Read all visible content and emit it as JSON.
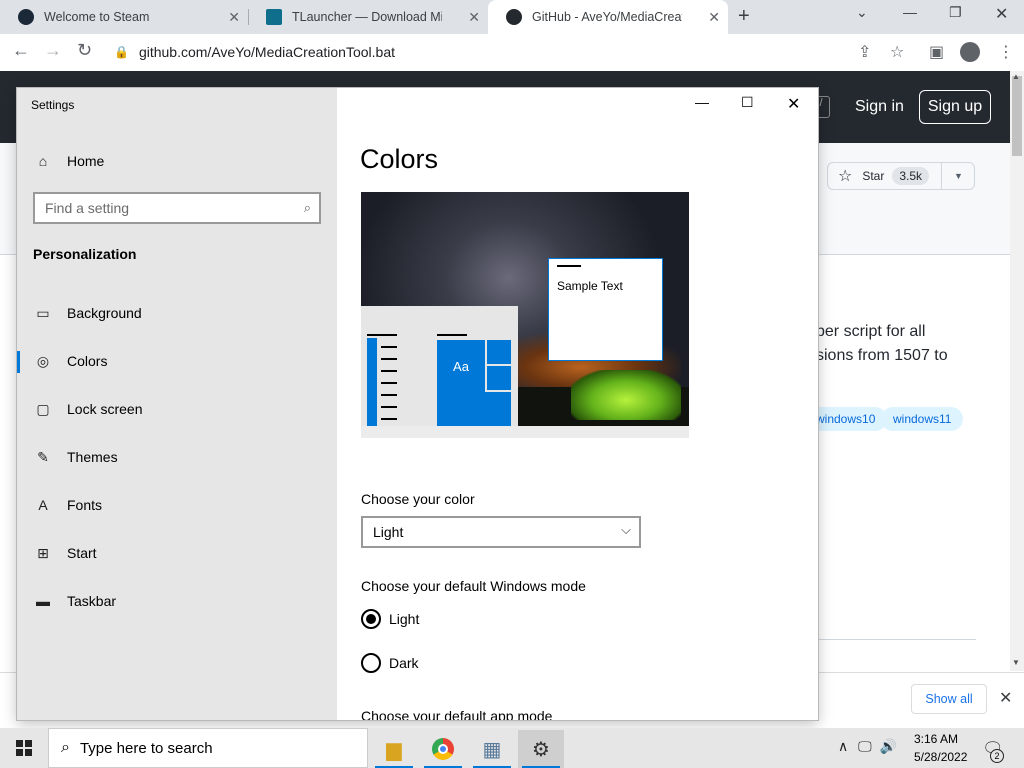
{
  "browser": {
    "tabs": [
      {
        "title": "Welcome to Steam",
        "active": false
      },
      {
        "title": "TLauncher — Download Minecra",
        "active": false
      },
      {
        "title": "GitHub - AveYo/MediaCreationTo",
        "active": true
      }
    ],
    "new_tab_label": "+",
    "url": "github.com/AveYo/MediaCreationTool.bat"
  },
  "github": {
    "sign_in": "Sign in",
    "sign_up": "Sign up",
    "slash": "/",
    "star_label": "Star",
    "star_count": "3.5k",
    "desc_line1": "per script for all",
    "desc_line2": "sions from 1507 to",
    "topics": [
      "windows10",
      "windows11"
    ]
  },
  "download_bar": {
    "show_all": "Show all"
  },
  "settings": {
    "window_title": "Settings",
    "home": "Home",
    "search_placeholder": "Find a setting",
    "section": "Personalization",
    "nav": [
      {
        "label": "Background",
        "icon": "picture-icon",
        "selected": false
      },
      {
        "label": "Colors",
        "icon": "palette-icon",
        "selected": true
      },
      {
        "label": "Lock screen",
        "icon": "lock-screen-icon",
        "selected": false
      },
      {
        "label": "Themes",
        "icon": "themes-icon",
        "selected": false
      },
      {
        "label": "Fonts",
        "icon": "fonts-icon",
        "selected": false
      },
      {
        "label": "Start",
        "icon": "start-icon",
        "selected": false
      },
      {
        "label": "Taskbar",
        "icon": "taskbar-icon",
        "selected": false
      }
    ],
    "page_title": "Colors",
    "preview": {
      "sample_text": "Sample Text",
      "tile_text": "Aa"
    },
    "choose_color_label": "Choose your color",
    "choose_color_value": "Light",
    "windows_mode_label": "Choose your default Windows mode",
    "windows_mode_options": [
      {
        "label": "Light",
        "checked": true
      },
      {
        "label": "Dark",
        "checked": false
      }
    ],
    "app_mode_label": "Choose your default app mode",
    "accent_color": "#0078d7"
  },
  "taskbar": {
    "search_placeholder": "Type here to search",
    "time": "3:16 AM",
    "date": "5/28/2022",
    "notification_count": "2"
  }
}
